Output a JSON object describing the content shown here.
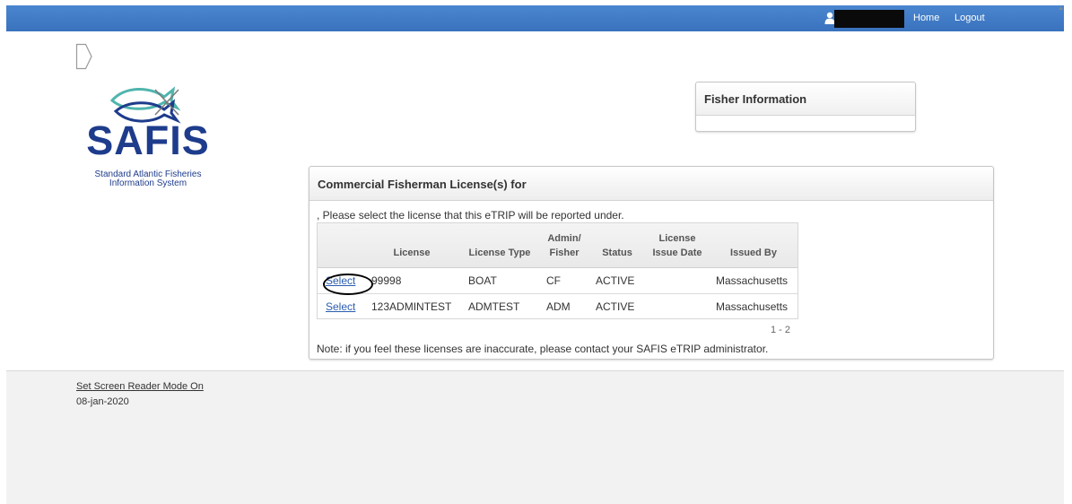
{
  "header": {
    "nav": {
      "home": "Home",
      "logout": "Logout"
    },
    "colors": {
      "bar": "#3f7ac4"
    }
  },
  "logo": {
    "word": "SAFIS",
    "tagline_line1": "Standard Atlantic Fisheries",
    "tagline_line2": "Information System",
    "colors": {
      "navy": "#1e3c8c",
      "teal": "#4fb5ad"
    }
  },
  "fisher_info": {
    "title": "Fisher Information"
  },
  "licenses": {
    "title": "Commercial Fisherman License(s) for",
    "instruction": ", Please select the license that this eTRIP will be reported under.",
    "columns": {
      "license": "License",
      "license_type": "License Type",
      "admin_fisher_1": "Admin/",
      "admin_fisher_2": "Fisher",
      "status": "Status",
      "issue_date_1": "License",
      "issue_date_2": "Issue Date",
      "issued_by": "Issued By"
    },
    "rows": [
      {
        "action": "Select",
        "license": "99998",
        "license_type": "BOAT",
        "admin_fisher": "CF",
        "status": "ACTIVE",
        "issue_date": "",
        "issued_by": "Massachusetts"
      },
      {
        "action": "Select",
        "license": "123ADMINTEST",
        "license_type": "ADMTEST",
        "admin_fisher": "ADM",
        "status": "ACTIVE",
        "issue_date": "",
        "issued_by": "Massachusetts"
      }
    ],
    "pager": "1 - 2",
    "note": "Note: if you feel these licenses are inaccurate, please contact your SAFIS eTRIP administrator."
  },
  "footer": {
    "screen_reader": "Set Screen Reader Mode On",
    "date": "08-jan-2020"
  }
}
